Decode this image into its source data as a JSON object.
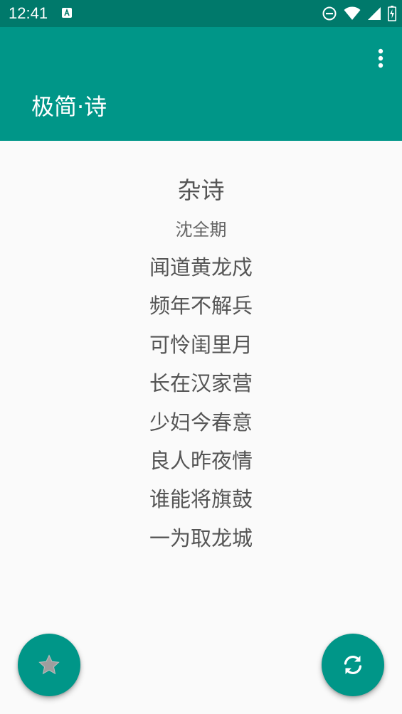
{
  "status_bar": {
    "time": "12:41",
    "icons": [
      "app-notification-icon",
      "do-not-disturb-icon",
      "wifi-icon",
      "cellular-signal-icon",
      "battery-icon"
    ]
  },
  "app_bar": {
    "title": "极简·诗",
    "menu_icon": "more-vert-icon"
  },
  "poem": {
    "title": "杂诗",
    "author": "沈全期",
    "lines": [
      "闻道黄龙戍",
      "频年不解兵",
      "可怜闺里月",
      "长在汉家营",
      "少妇今春意",
      "良人昨夜情",
      "谁能将旗鼓",
      "一为取龙城"
    ]
  },
  "fabs": {
    "left_icon": "star-icon",
    "right_icon": "refresh-icon"
  },
  "colors": {
    "status_bar": "#00796b",
    "app_bar": "#009688",
    "accent": "#009688",
    "text": "#555555",
    "background": "#fafafa"
  }
}
